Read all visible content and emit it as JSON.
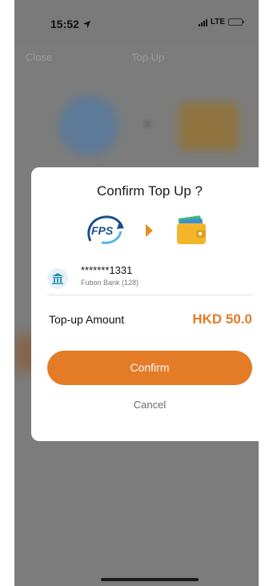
{
  "status_bar": {
    "time": "15:52",
    "network": "LTE"
  },
  "background": {
    "close_label": "Close",
    "title": "Top Up"
  },
  "dialog": {
    "title": "Confirm Top Up ?",
    "bank": {
      "account_masked": "*******1331",
      "name": "Fubon Bank (128)"
    },
    "amount_label": "Top-up Amount",
    "amount_value": "HKD 50.0",
    "confirm_label": "Confirm",
    "cancel_label": "Cancel"
  },
  "colors": {
    "accent": "#e37b27",
    "fps_blue": "#1b4f8a",
    "wallet_yellow": "#f3b62a"
  },
  "icons": [
    "location-arrow-icon",
    "signal-icon",
    "battery-icon",
    "fps-logo-icon",
    "arrow-right-icon",
    "wallet-icon",
    "bank-icon"
  ]
}
